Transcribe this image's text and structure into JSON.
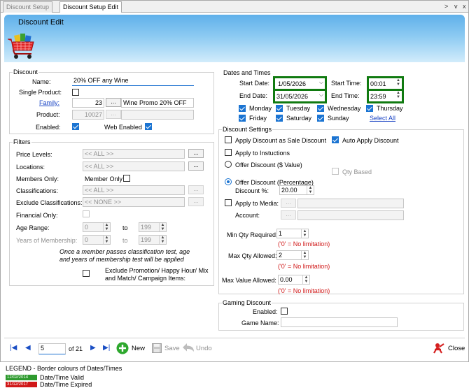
{
  "tabs": {
    "inactive": "Discount Setup",
    "active": "Discount Setup Edit"
  },
  "window_controls": {
    "pin": ">",
    "min": "v",
    "close": "x"
  },
  "header": {
    "title": "Discount Edit",
    "icon": "shopping-cart-icon"
  },
  "discount": {
    "group_title": "Discount",
    "name_label": "Name:",
    "name_value": "20% OFF any Wine",
    "single_product_label": "Single Product:",
    "family_label": "Family:",
    "family_code": "23",
    "family_name": "Wine Promo 20% OFF",
    "product_label": "Product:",
    "product_code": "10027",
    "enabled_label": "Enabled:",
    "web_enabled_label": "Web Enabled",
    "browse": "..."
  },
  "filters": {
    "group_title": "Filters",
    "price_levels_label": "Price Levels:",
    "price_levels_value": "<< ALL >>",
    "locations_label": "Locations:",
    "locations_value": "<< ALL >>",
    "members_only_label": "Members Only:",
    "member_only_label": "Member Only",
    "classifications_label": "Classifications:",
    "classifications_value": "<< ALL >>",
    "exclude_classifications_label": "Exclude Classifications:",
    "exclude_classifications_value": "<< NONE >>",
    "financial_only_label": "Financial Only:",
    "age_range_label": "Age Range:",
    "age_from": "0",
    "age_to": "199",
    "to_label": "to",
    "years_membership_label": "Years of Membership:",
    "years_from": "0",
    "years_to": "199",
    "note": "Once a member passes classification test, age and years of membership test will be applied",
    "exclude_promo_label": "Exclude Promotion/ Happy Hour/ Mix and Match/ Campaign Items:"
  },
  "dates": {
    "group_title": "Dates and Times",
    "start_date_label": "Start Date:",
    "start_date": "1/05/2026",
    "end_date_label": "End Date:",
    "end_date": "31/05/2026",
    "start_time_label": "Start Time:",
    "start_time": "00:01",
    "end_time_label": "End Time:",
    "end_time": "23:59",
    "days": {
      "mon": "Monday",
      "tue": "Tuesday",
      "wed": "Wednesday",
      "thu": "Thursday",
      "fri": "Friday",
      "sat": "Saturday",
      "sun": "Sunday"
    },
    "select_all": "Select All"
  },
  "settings": {
    "group_title": "Discount Settings",
    "apply_sale_label": "Apply Discount as Sale Discount",
    "auto_apply_label": "Auto Apply Discount",
    "apply_instructions_label": "Apply to Instuctions",
    "offer_value_label": "Offer Discount ($ Value)",
    "qty_based_label": "Qty Based",
    "offer_pct_label": "Offer Discount (Percentage)",
    "discount_pct_label": "Discount %:",
    "discount_pct": "20.00",
    "apply_media_label": "Apply to Media:",
    "account_label": "Account:",
    "min_qty_label": "Min Qty Required:",
    "min_qty": "1",
    "max_qty_label": "Max Qty Allowed:",
    "max_qty": "2",
    "max_value_label": "Max Value Allowed:",
    "max_value": "0.00",
    "no_limit": "('0' = No limitation)"
  },
  "gaming": {
    "group_title": "Gaming Discount",
    "enabled_label": "Enabled:",
    "game_name_label": "Game Name:"
  },
  "toolbar": {
    "record": "5",
    "of_label": "of 21",
    "new_label": "New",
    "save_label": "Save",
    "undo_label": "Undo",
    "close_label": "Close"
  },
  "legend": {
    "title": "LEGEND - Border colours of Dates/Times",
    "valid_date": "12/02/2014",
    "valid_label": "Date/Time Valid",
    "valid_color": "#2e9a2e",
    "expired_date": "31/12/2017",
    "expired_label": "Date/Time Expired",
    "expired_color": "#d01818"
  },
  "colors": {
    "valid_border": "#107a10",
    "accent": "#1b74d2",
    "header_gradient_top": "#5fb0ea"
  }
}
